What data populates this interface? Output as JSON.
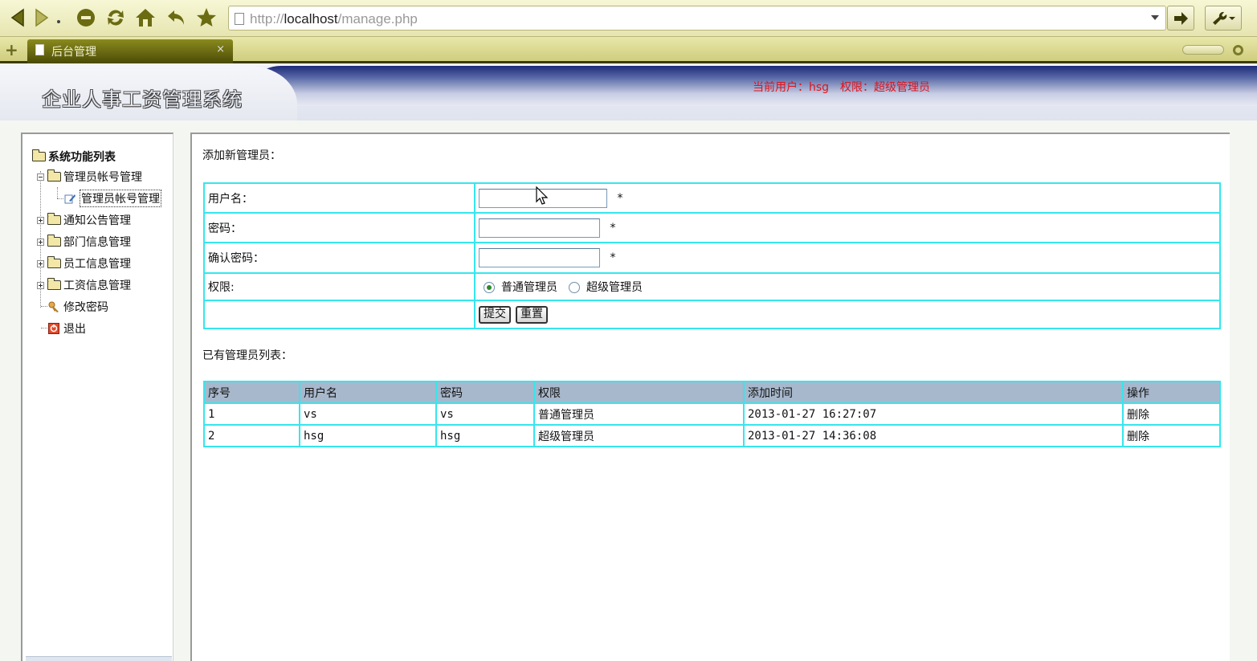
{
  "browser": {
    "nav_icons": [
      "back-icon",
      "forward-icon",
      "stop-icon",
      "reload-icon",
      "home-icon",
      "undo-icon",
      "bookmark-star-icon"
    ],
    "url_scheme": "http://",
    "url_host": "localhost",
    "url_path": "/manage.php",
    "go_icon": "arrow-right-icon",
    "tools_icon": "wrench-icon",
    "tab_title": "后台管理",
    "tab_close": "×"
  },
  "header": {
    "site_title": "企业人事工资管理系统",
    "user_line": "当前用户：hsg　权限：超级管理员",
    "accent_color": "#e0141c"
  },
  "sidebar": {
    "root_label": "系统功能列表",
    "items": [
      {
        "label": "管理员帐号管理",
        "expanded": true
      },
      {
        "label": "管理员帐号管理",
        "leaf": true,
        "icon": "edit-icon"
      },
      {
        "label": "通知公告管理",
        "expanded": false
      },
      {
        "label": "部门信息管理",
        "expanded": false
      },
      {
        "label": "员工信息管理",
        "expanded": false
      },
      {
        "label": "工资信息管理",
        "expanded": false
      },
      {
        "label": "修改密码",
        "leaf": true,
        "icon": "key-icon"
      },
      {
        "label": "退出",
        "leaf": true,
        "icon": "exit-icon"
      }
    ]
  },
  "form": {
    "title": "添加新管理员：",
    "username_label": "用户名：",
    "password_label": "密码：",
    "confirm_label": "确认密码：",
    "role_label": "权限:",
    "required_mark": "*",
    "role_options": [
      {
        "label": "普通管理员",
        "checked": true
      },
      {
        "label": "超级管理员",
        "checked": false
      }
    ],
    "submit_label": "提交",
    "reset_label": "重置"
  },
  "list": {
    "title": "已有管理员列表：",
    "columns": [
      "序号",
      "用户名",
      "密码",
      "权限",
      "添加时间",
      "操作"
    ],
    "rows": [
      [
        "1",
        "vs",
        "vs",
        "普通管理员",
        "2013-01-27 16:27:07",
        "删除"
      ],
      [
        "2",
        "hsg",
        "hsg",
        "超级管理员",
        "2013-01-27 14:36:08",
        "删除"
      ]
    ],
    "border_color": "#35e6ee",
    "header_bg": "#a8b8cc"
  }
}
